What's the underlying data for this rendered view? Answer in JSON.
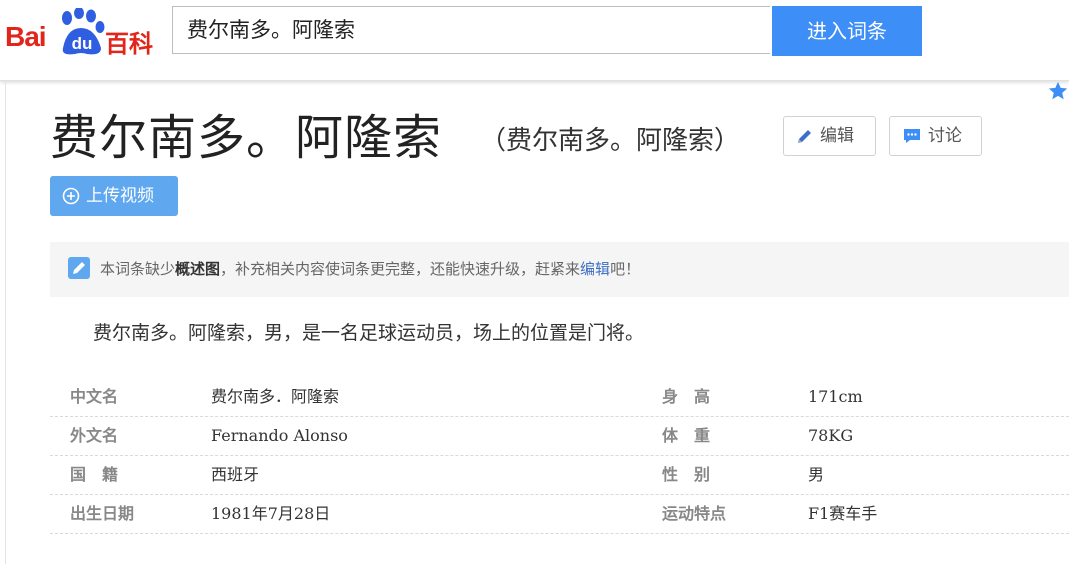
{
  "header": {
    "logo": {
      "bai": "Bai",
      "du": "du",
      "baike": "百科"
    },
    "search": {
      "value": "费尔南多。阿隆索"
    },
    "search_button": "进入词条"
  },
  "entry": {
    "title": "费尔南多。阿隆索",
    "subtitle": "（费尔南多。阿隆索）",
    "edit_label": "编辑",
    "discuss_label": "讨论",
    "upload_label": "上传视频"
  },
  "notice": {
    "part1": "本词条缺少",
    "bold": "概述图",
    "part2": "，补充相关内容使词条更完整，还能快速升级，赶紧来",
    "link": "编辑",
    "part3": "吧！"
  },
  "summary": "费尔南多。阿隆索，男，是一名足球运动员，场上的位置是门将。",
  "info": [
    {
      "k1": "中文名",
      "v1": "费尔南多．阿隆索",
      "k2": "身　高",
      "v2": "171cm"
    },
    {
      "k1": "外文名",
      "v1": "Fernando Alonso",
      "k2": "体　重",
      "v2": "78KG"
    },
    {
      "k1": "国　籍",
      "v1": "西班牙",
      "k2": "性　别",
      "v2": "男"
    },
    {
      "k1": "出生日期",
      "v1": "1981年7月28日",
      "k2": "运动特点",
      "v2": "F1赛车手"
    }
  ],
  "colors": {
    "brand_red": "#e1251b",
    "brand_blue": "#3e8ef7",
    "upload_blue": "#5fa7ee",
    "link": "#3e6ec5"
  },
  "icons": [
    "paw-logo-icon",
    "star-icon",
    "pencil-icon",
    "chat-bubble-icon",
    "plus-circle-icon",
    "edit-note-icon"
  ]
}
